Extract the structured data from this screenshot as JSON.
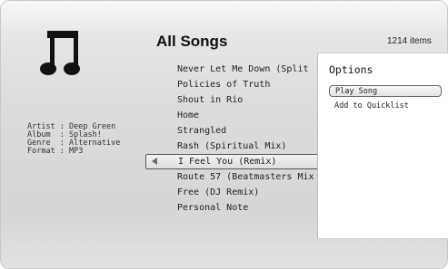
{
  "header": {
    "title": "All Songs",
    "item_count": "1214 items"
  },
  "now_info": {
    "icon": "music-note-icon",
    "rows": [
      "Artist : Deep Green",
      "Album  : Splash!",
      "Genre  : Alternative",
      "Format : MP3"
    ]
  },
  "songs": [
    "Never Let Me Down (Split",
    "Policies of Truth",
    "Shout in Rio",
    "Home",
    "Strangled",
    "Rash (Spiritual Mix)",
    "I Feel You (Remix)",
    "Route 57 (Beatmasters Mix",
    "Free (DJ Remix)",
    "Personal Note"
  ],
  "selected_index": 6,
  "options": {
    "title": "Options",
    "items": [
      "Play Song",
      "Add to Quicklist"
    ],
    "highlighted": "Play Song"
  }
}
